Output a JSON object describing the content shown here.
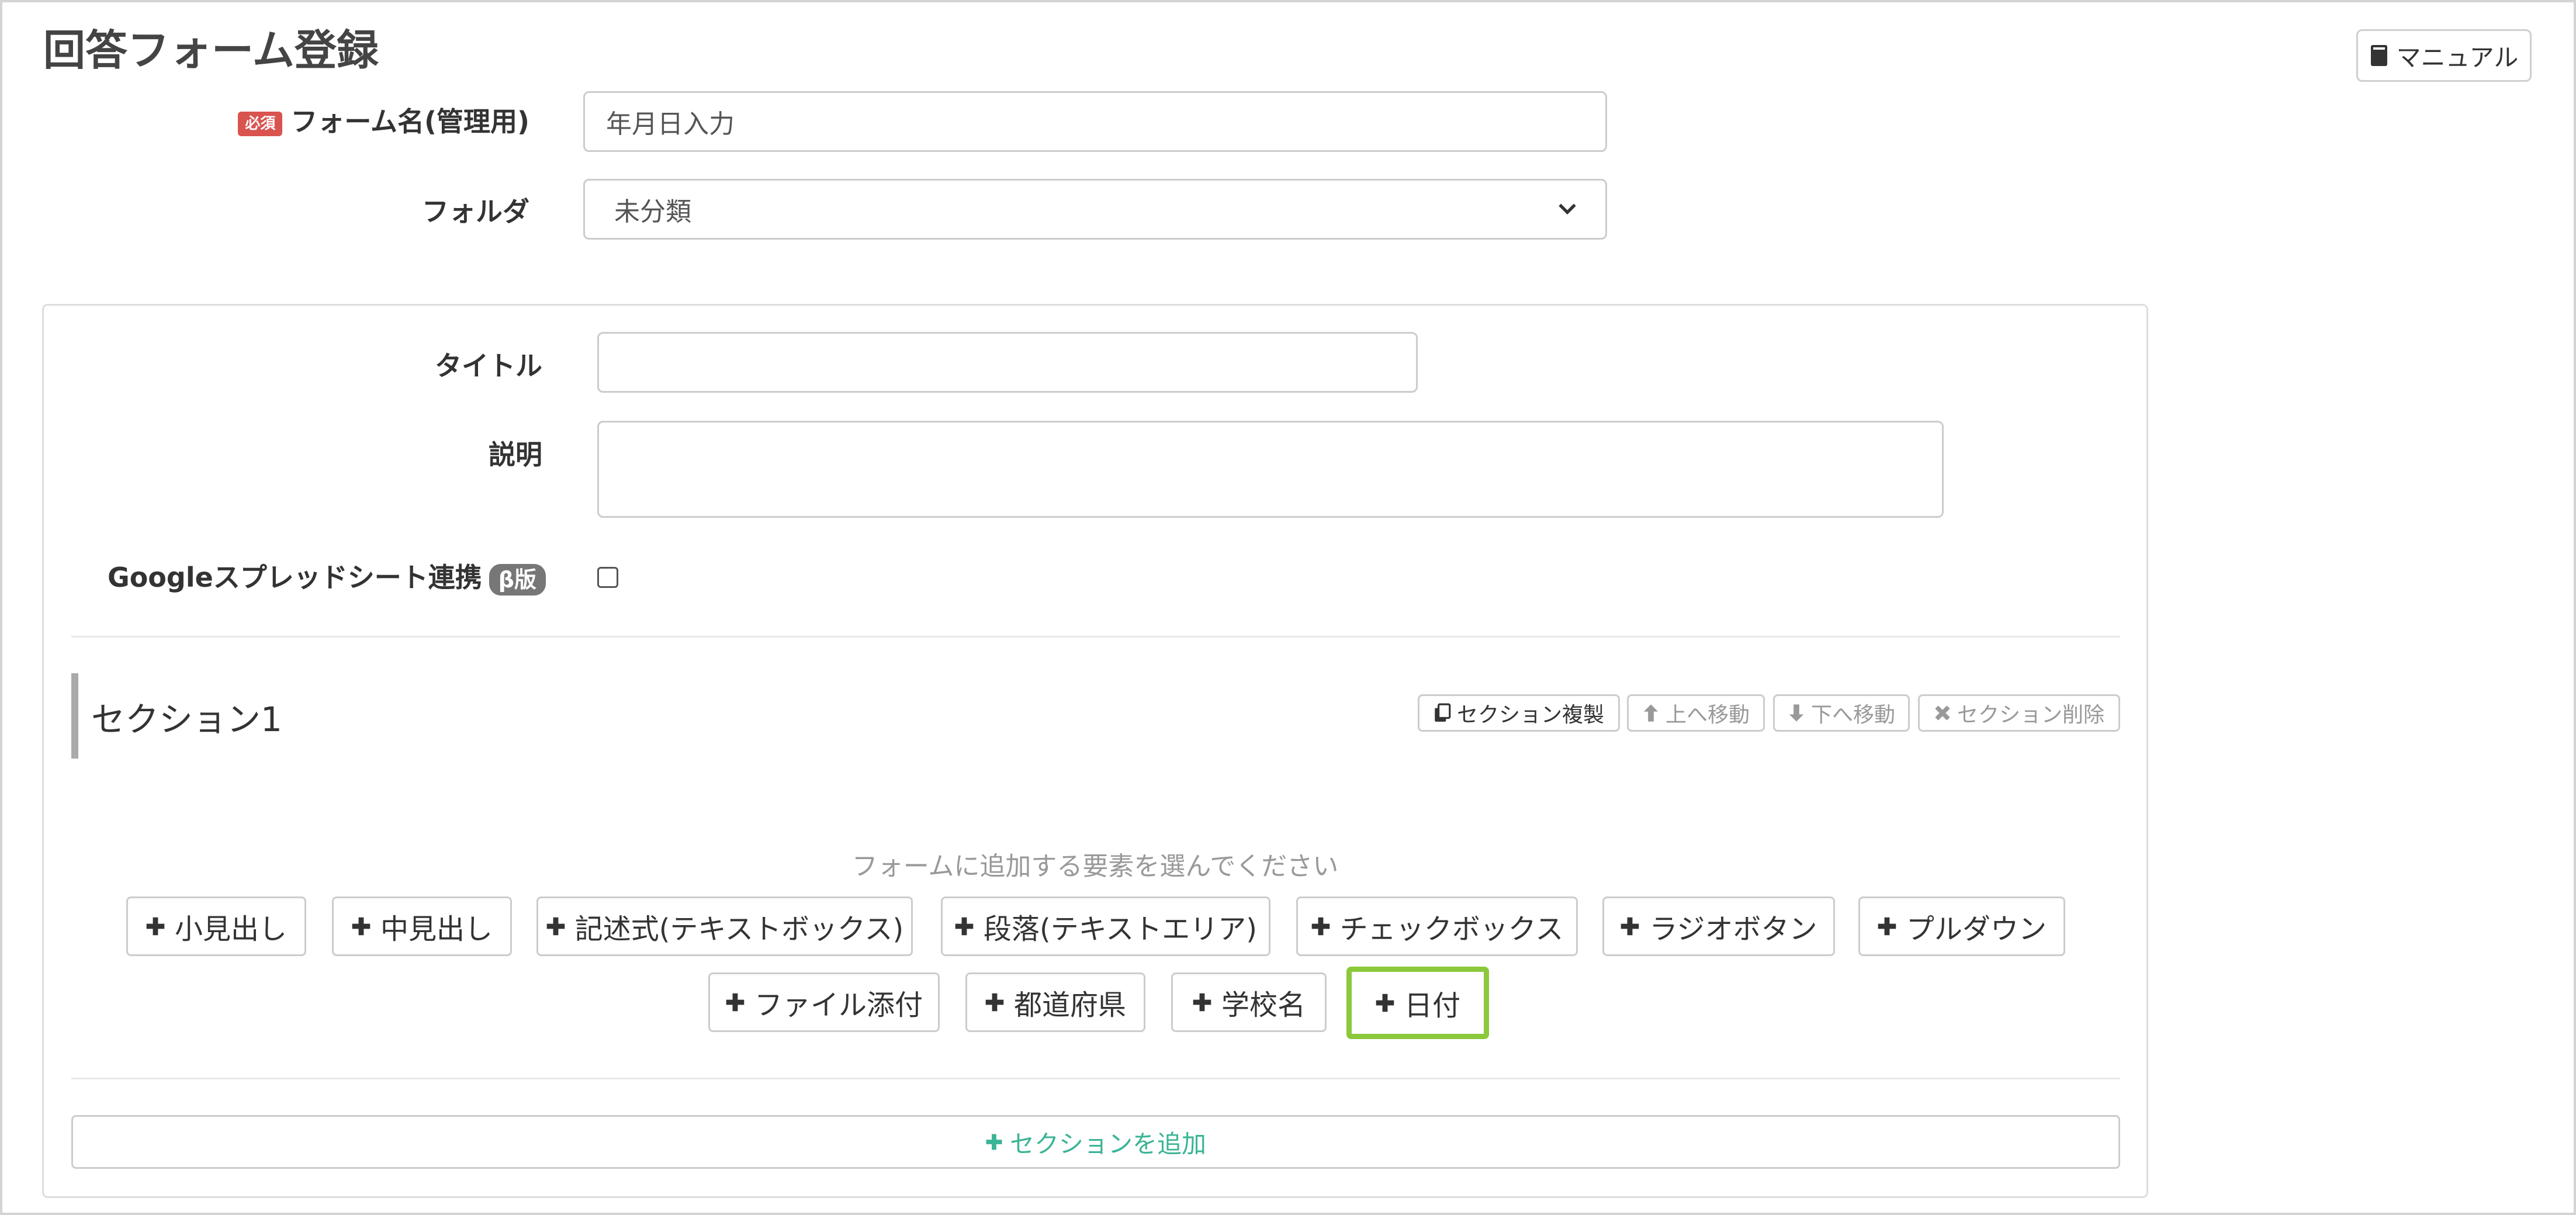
{
  "page": {
    "title": "回答フォーム登録",
    "manual_label": "マニュアル"
  },
  "form": {
    "required_badge": "必須",
    "form_name_label": "フォーム名(管理用)",
    "form_name_value": "年月日入力",
    "folder_label": "フォルダ",
    "folder_value": "未分類",
    "title_label": "タイトル",
    "title_value": "",
    "description_label": "説明",
    "description_value": "",
    "spreadsheet_label": "Googleスプレッドシート連携",
    "beta_badge": "β版",
    "spreadsheet_checked": false
  },
  "section": {
    "title": "セクション1",
    "actions": {
      "duplicate": "セクション複製",
      "move_up": "上へ移動",
      "move_down": "下へ移動",
      "delete": "セクション削除"
    },
    "prompt": "フォームに追加する要素を選んでください",
    "elements_row1": [
      "小見出し",
      "中見出し",
      "記述式(テキストボックス)",
      "段落(テキストエリア)",
      "チェックボックス",
      "ラジオボタン",
      "プルダウン"
    ],
    "elements_row2": [
      "ファイル添付",
      "都道府県",
      "学校名",
      "日付"
    ]
  },
  "add_section_label": "セクションを追加",
  "colors": {
    "required": "#d9534f",
    "highlight": "#8cc83c",
    "add_section": "#3cb496",
    "beta": "#777777"
  }
}
